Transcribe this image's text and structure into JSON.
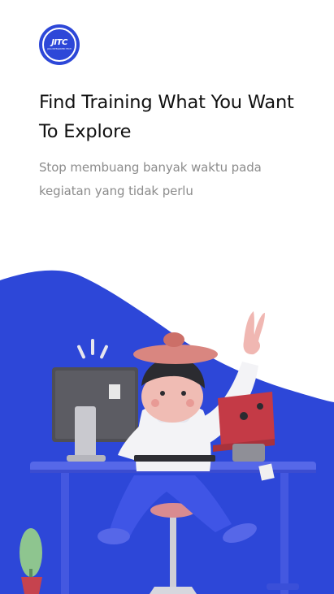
{
  "logo": {
    "text": "JITC",
    "subtext": "JAVA INTEGRATED TECH"
  },
  "onboarding": {
    "title": "Find Training What You Want To Explore",
    "subtitle": "Stop membuang banyak waktu pada kegiatan yang tidak perlu"
  },
  "colors": {
    "brand": "#2d47d8",
    "title": "#111111",
    "subtitle": "#8c8c8c",
    "background": "#ffffff"
  },
  "illustration": {
    "icon": "person-at-desk-illustration"
  }
}
